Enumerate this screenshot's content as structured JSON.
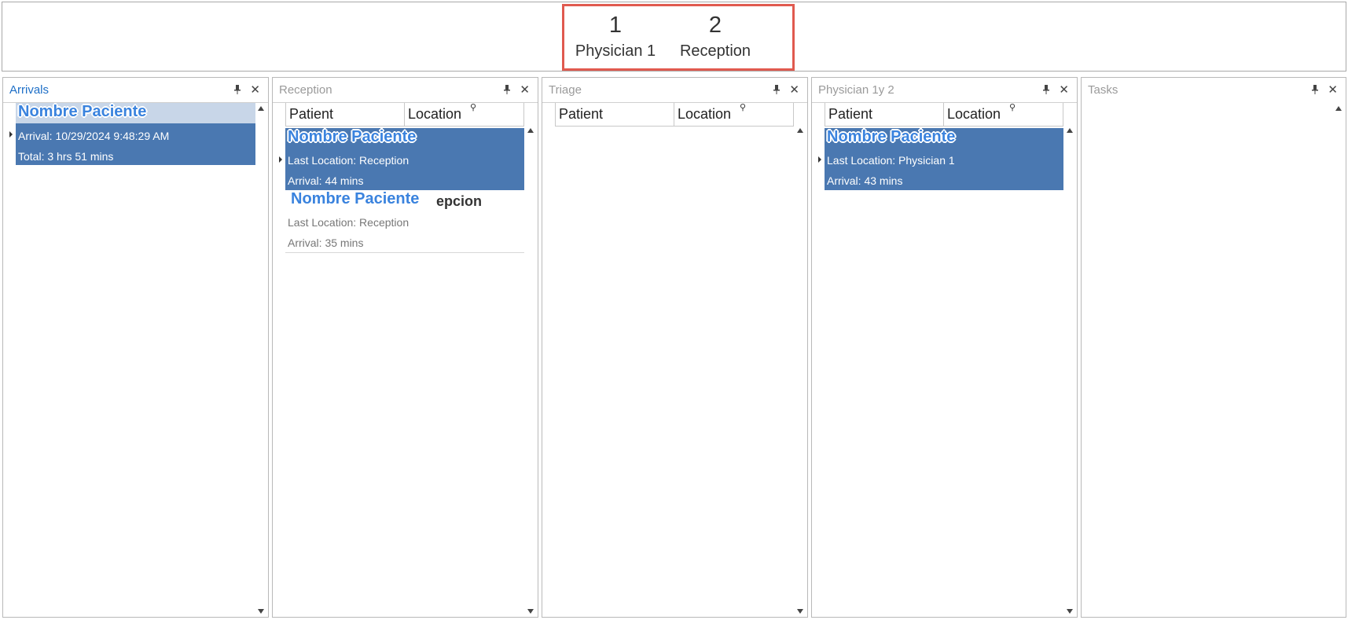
{
  "counters": [
    {
      "value": "1",
      "label": "Physician 1"
    },
    {
      "value": "2",
      "label": "Reception"
    }
  ],
  "panels": {
    "arrivals": {
      "title": "Arrivals",
      "records": [
        {
          "name": "Nombre Paciente",
          "line1": "Arrival:  10/29/2024 9:48:29 AM",
          "line2": "Total:  3 hrs 51 mins"
        }
      ]
    },
    "reception": {
      "title": "Reception",
      "columns": [
        "Patient",
        "Location"
      ],
      "records": [
        {
          "name": "Nombre Paciente",
          "line1": "Last Location:  Reception",
          "line2": "Arrival:   44 mins"
        },
        {
          "name": "Nombre Paciente",
          "partial_text": "epcion",
          "line1": "Last Location:  Reception",
          "line2": "Arrival:   35 mins"
        }
      ]
    },
    "triage": {
      "title": "Triage",
      "columns": [
        "Patient",
        "Location"
      ]
    },
    "physician": {
      "title": "Physician 1y 2",
      "columns": [
        "Patient",
        "Location"
      ],
      "records": [
        {
          "name": "Nombre Paciente",
          "line1": "Last Location:  Physician 1",
          "line2": "Arrival:   43 mins"
        }
      ]
    },
    "tasks": {
      "title": "Tasks"
    }
  },
  "colors": {
    "accent_border": "#e05a4f",
    "selected_row": "#4a78b1",
    "active_title": "#1e6fc7",
    "patient_name": "#3a83de"
  }
}
